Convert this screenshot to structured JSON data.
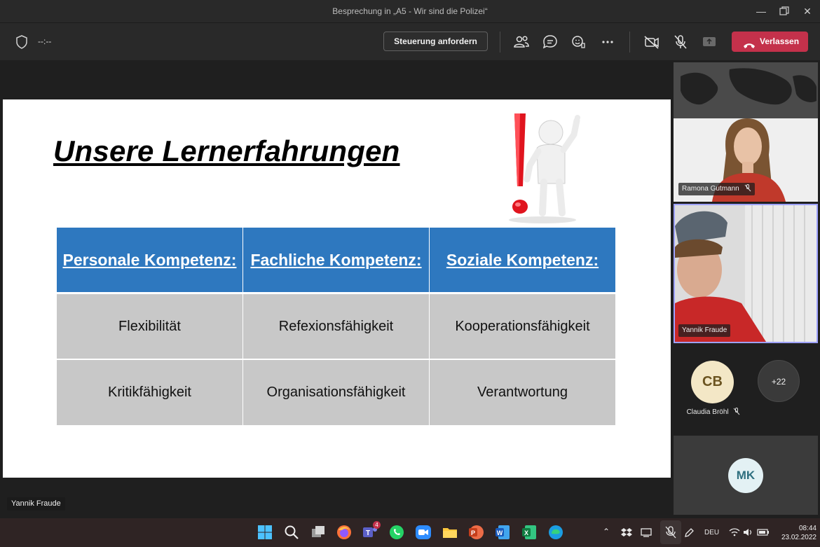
{
  "window": {
    "title": "Besprechung in „A5 - Wir sind die Polizei“",
    "controls": [
      "minimize",
      "restore",
      "close"
    ]
  },
  "toolbar": {
    "timer": "--:--",
    "request_control_label": "Steuerung anfordern",
    "leave_label": "Verlassen",
    "icons": [
      "participants-icon",
      "chat-icon",
      "reactions-icon",
      "more-icon",
      "camera-off-icon",
      "mic-off-icon",
      "share-icon"
    ]
  },
  "slide": {
    "title": "Unsere Lernerfahrungen",
    "headers": [
      "Personale Kompetenz:",
      "Fachliche Kompetenz:",
      "Soziale Kompetenz:"
    ],
    "rows": [
      [
        "Flexibilität",
        "Refexionsfähigkeit",
        "Kooperationsfähigkeit"
      ],
      [
        "Kritikfähigkeit",
        "Organisationsfähigkeit",
        "Verantwortung"
      ]
    ]
  },
  "presenter_name": "Yannik Fraude",
  "participants": {
    "tile1_name": "Ramona Gutmann",
    "tile2_name": "Yannik Fraude",
    "avatar_cb_initials": "CB",
    "avatar_cb_name": "Claudia Bröhl",
    "overflow_count": "+22",
    "avatar_mk_initials": "MK"
  },
  "taskbar": {
    "teams_badge": "4",
    "language": "DEU",
    "time": "08:44",
    "date": "23.02.2022"
  },
  "colors": {
    "leave": "#c4314b",
    "table_header": "#2e78bf",
    "table_body": "#c8c8c8",
    "avatar_cb_bg": "#f3e7c6"
  }
}
